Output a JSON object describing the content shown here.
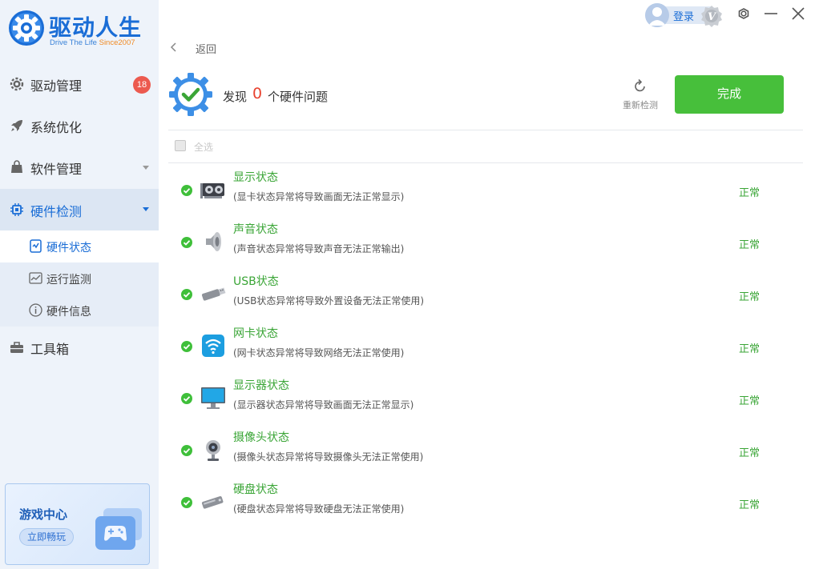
{
  "app": {
    "title": "驱动人生",
    "subtitle_prefix": "Drive The Life",
    "subtitle_since": "Since2007",
    "brand_color": "#1a6dd6"
  },
  "sidebar": {
    "items": [
      {
        "label": "驱动管理",
        "icon": "gear-icon",
        "badge": "18"
      },
      {
        "label": "系统优化",
        "icon": "rocket-icon"
      },
      {
        "label": "软件管理",
        "icon": "bag-icon"
      },
      {
        "label": "硬件检测",
        "icon": "chip-icon"
      },
      {
        "label": "工具箱",
        "icon": "toolbox-icon"
      }
    ],
    "sub_items": [
      {
        "label": "硬件状态",
        "icon": "hardware-status-icon"
      },
      {
        "label": "运行监测",
        "icon": "monitor-chart-icon"
      },
      {
        "label": "硬件信息",
        "icon": "info-icon"
      }
    ],
    "game_card": {
      "title": "游戏中心",
      "button": "立即畅玩"
    }
  },
  "topbar": {
    "login": "登录"
  },
  "main": {
    "back": "返回",
    "found_prefix": "发现",
    "found_count": "0",
    "found_suffix": "个硬件问题",
    "rescan": "重新检测",
    "done": "完成",
    "select_all": "全选",
    "status_color": "#3aa536",
    "rows": [
      {
        "name": "显示状态",
        "desc": "(显卡状态异常将导致画面无法正常显示)",
        "status": "正常",
        "icon": "graphics-card-icon"
      },
      {
        "name": "声音状态",
        "desc": "(声音状态异常将导致声音无法正常输出)",
        "status": "正常",
        "icon": "speaker-icon"
      },
      {
        "name": "USB状态",
        "desc": "(USB状态异常将导致外置设备无法正常使用)",
        "status": "正常",
        "icon": "usb-icon"
      },
      {
        "name": "网卡状态",
        "desc": "(网卡状态异常将导致网络无法正常使用)",
        "status": "正常",
        "icon": "wifi-icon"
      },
      {
        "name": "显示器状态",
        "desc": "(显示器状态异常将导致画面无法正常显示)",
        "status": "正常",
        "icon": "monitor-icon"
      },
      {
        "name": "摄像头状态",
        "desc": "(摄像头状态异常将导致摄像头无法正常使用)",
        "status": "正常",
        "icon": "webcam-icon"
      },
      {
        "name": "硬盘状态",
        "desc": "(硬盘状态异常将导致硬盘无法正常使用)",
        "status": "正常",
        "icon": "hard-disk-icon"
      }
    ]
  }
}
